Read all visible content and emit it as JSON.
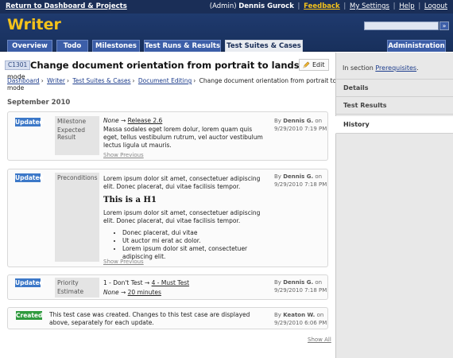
{
  "topbar": {
    "back_link": "Return to Dashboard & Projects",
    "admin_prefix": "(Admin)",
    "user_name": "Dennis Gurock",
    "links": [
      "Feedback",
      "My Settings",
      "Help",
      "Logout"
    ]
  },
  "header": {
    "title": "Writer",
    "search_button": "»"
  },
  "tabs": [
    "Overview",
    "Todo",
    "Milestones",
    "Test Runs & Results",
    "Test Suites & Cases",
    "Administration"
  ],
  "case": {
    "id": "C1301",
    "title": "Change document orientation from portrait to landscape",
    "title_cont": "mode",
    "edit_label": "Edit"
  },
  "breadcrumb": [
    "Dashboard",
    "Writer",
    "Test Suites & Cases",
    "Document Editing",
    "Change document orientation from portrait to landscape"
  ],
  "breadcrumb_tail": "mode",
  "month": "September 2010",
  "changes": [
    {
      "badge": "Updated",
      "labels": [
        "Milestone",
        "Expected Result"
      ],
      "values": {
        "milestone_from": "None",
        "arrow": "→",
        "milestone_to": "Release 2.6",
        "expected": "Massa sodales eget lorem dolur, lorem quam quis eget, tellus vestibulum rutrum, vel auctor vestibulum lectus ligula ut mauris."
      },
      "by_prefix": "By",
      "author": "Dennis G.",
      "on": "on",
      "date": "9/29/2010 7:19 PM",
      "show_previous": "Show Previous"
    },
    {
      "badge": "Updated",
      "labels": [
        "Preconditions"
      ],
      "values": {
        "para1": "Lorem ipsum dolor sit amet, consectetuer adipiscing elit. Donec placerat, dui vitae facilisis tempor.",
        "heading": "This is a H1",
        "para2": "Lorem ipsum dolor sit amet, consectetuer adipiscing elit. Donec placerat, dui vitae facilisis tempor.",
        "bullets": [
          "Donec placerat, dui vitae",
          "Ut auctor mi erat ac dolor.",
          "Lorem ipsum dolor sit amet, consectetuer adipiscing elit."
        ]
      },
      "by_prefix": "By",
      "author": "Dennis G.",
      "on": "on",
      "date": "9/29/2010 7:18 PM",
      "show_previous": "Show Previous"
    },
    {
      "badge": "Updated",
      "labels": [
        "Priority",
        "Estimate"
      ],
      "values": {
        "priority_from": "1 - Don't Test",
        "arrow": "→",
        "priority_to": "4 - Must Test",
        "estimate_from": "None",
        "estimate_to": "20 minutes"
      },
      "by_prefix": "By",
      "author": "Dennis G.",
      "on": "on",
      "date": "9/29/2010 7:18 PM"
    },
    {
      "badge": "Created",
      "text": "This test case was created. Changes to this test case are displayed above, separately for each update.",
      "by_prefix": "By",
      "author": "Keaton W.",
      "on": "on",
      "date": "9/29/2010 6:06 PM"
    }
  ],
  "show_all": "Show All",
  "sidebar": {
    "in_section_prefix": "In section",
    "section_link": "Prerequisites",
    "section_suffix": ".",
    "items": [
      "Details",
      "Test Results",
      "History"
    ]
  },
  "colors": {
    "topbar": "#1a2e57",
    "header": "#1f3a6e",
    "title_yellow": "#f4c21b",
    "tab_blue": "#3c5ea8",
    "updated_badge": "#3c78c8",
    "created_badge": "#2f9a3e"
  }
}
